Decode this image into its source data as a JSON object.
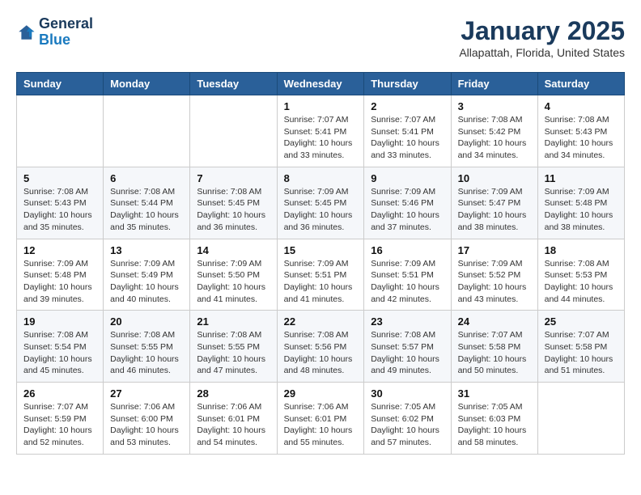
{
  "header": {
    "logo_line1": "General",
    "logo_line2": "Blue",
    "month_title": "January 2025",
    "location": "Allapattah, Florida, United States"
  },
  "days_of_week": [
    "Sunday",
    "Monday",
    "Tuesday",
    "Wednesday",
    "Thursday",
    "Friday",
    "Saturday"
  ],
  "weeks": [
    [
      {
        "day": "",
        "sunrise": "",
        "sunset": "",
        "daylight": ""
      },
      {
        "day": "",
        "sunrise": "",
        "sunset": "",
        "daylight": ""
      },
      {
        "day": "",
        "sunrise": "",
        "sunset": "",
        "daylight": ""
      },
      {
        "day": "1",
        "sunrise": "Sunrise: 7:07 AM",
        "sunset": "Sunset: 5:41 PM",
        "daylight": "Daylight: 10 hours and 33 minutes."
      },
      {
        "day": "2",
        "sunrise": "Sunrise: 7:07 AM",
        "sunset": "Sunset: 5:41 PM",
        "daylight": "Daylight: 10 hours and 33 minutes."
      },
      {
        "day": "3",
        "sunrise": "Sunrise: 7:08 AM",
        "sunset": "Sunset: 5:42 PM",
        "daylight": "Daylight: 10 hours and 34 minutes."
      },
      {
        "day": "4",
        "sunrise": "Sunrise: 7:08 AM",
        "sunset": "Sunset: 5:43 PM",
        "daylight": "Daylight: 10 hours and 34 minutes."
      }
    ],
    [
      {
        "day": "5",
        "sunrise": "Sunrise: 7:08 AM",
        "sunset": "Sunset: 5:43 PM",
        "daylight": "Daylight: 10 hours and 35 minutes."
      },
      {
        "day": "6",
        "sunrise": "Sunrise: 7:08 AM",
        "sunset": "Sunset: 5:44 PM",
        "daylight": "Daylight: 10 hours and 35 minutes."
      },
      {
        "day": "7",
        "sunrise": "Sunrise: 7:08 AM",
        "sunset": "Sunset: 5:45 PM",
        "daylight": "Daylight: 10 hours and 36 minutes."
      },
      {
        "day": "8",
        "sunrise": "Sunrise: 7:09 AM",
        "sunset": "Sunset: 5:45 PM",
        "daylight": "Daylight: 10 hours and 36 minutes."
      },
      {
        "day": "9",
        "sunrise": "Sunrise: 7:09 AM",
        "sunset": "Sunset: 5:46 PM",
        "daylight": "Daylight: 10 hours and 37 minutes."
      },
      {
        "day": "10",
        "sunrise": "Sunrise: 7:09 AM",
        "sunset": "Sunset: 5:47 PM",
        "daylight": "Daylight: 10 hours and 38 minutes."
      },
      {
        "day": "11",
        "sunrise": "Sunrise: 7:09 AM",
        "sunset": "Sunset: 5:48 PM",
        "daylight": "Daylight: 10 hours and 38 minutes."
      }
    ],
    [
      {
        "day": "12",
        "sunrise": "Sunrise: 7:09 AM",
        "sunset": "Sunset: 5:48 PM",
        "daylight": "Daylight: 10 hours and 39 minutes."
      },
      {
        "day": "13",
        "sunrise": "Sunrise: 7:09 AM",
        "sunset": "Sunset: 5:49 PM",
        "daylight": "Daylight: 10 hours and 40 minutes."
      },
      {
        "day": "14",
        "sunrise": "Sunrise: 7:09 AM",
        "sunset": "Sunset: 5:50 PM",
        "daylight": "Daylight: 10 hours and 41 minutes."
      },
      {
        "day": "15",
        "sunrise": "Sunrise: 7:09 AM",
        "sunset": "Sunset: 5:51 PM",
        "daylight": "Daylight: 10 hours and 41 minutes."
      },
      {
        "day": "16",
        "sunrise": "Sunrise: 7:09 AM",
        "sunset": "Sunset: 5:51 PM",
        "daylight": "Daylight: 10 hours and 42 minutes."
      },
      {
        "day": "17",
        "sunrise": "Sunrise: 7:09 AM",
        "sunset": "Sunset: 5:52 PM",
        "daylight": "Daylight: 10 hours and 43 minutes."
      },
      {
        "day": "18",
        "sunrise": "Sunrise: 7:08 AM",
        "sunset": "Sunset: 5:53 PM",
        "daylight": "Daylight: 10 hours and 44 minutes."
      }
    ],
    [
      {
        "day": "19",
        "sunrise": "Sunrise: 7:08 AM",
        "sunset": "Sunset: 5:54 PM",
        "daylight": "Daylight: 10 hours and 45 minutes."
      },
      {
        "day": "20",
        "sunrise": "Sunrise: 7:08 AM",
        "sunset": "Sunset: 5:55 PM",
        "daylight": "Daylight: 10 hours and 46 minutes."
      },
      {
        "day": "21",
        "sunrise": "Sunrise: 7:08 AM",
        "sunset": "Sunset: 5:55 PM",
        "daylight": "Daylight: 10 hours and 47 minutes."
      },
      {
        "day": "22",
        "sunrise": "Sunrise: 7:08 AM",
        "sunset": "Sunset: 5:56 PM",
        "daylight": "Daylight: 10 hours and 48 minutes."
      },
      {
        "day": "23",
        "sunrise": "Sunrise: 7:08 AM",
        "sunset": "Sunset: 5:57 PM",
        "daylight": "Daylight: 10 hours and 49 minutes."
      },
      {
        "day": "24",
        "sunrise": "Sunrise: 7:07 AM",
        "sunset": "Sunset: 5:58 PM",
        "daylight": "Daylight: 10 hours and 50 minutes."
      },
      {
        "day": "25",
        "sunrise": "Sunrise: 7:07 AM",
        "sunset": "Sunset: 5:58 PM",
        "daylight": "Daylight: 10 hours and 51 minutes."
      }
    ],
    [
      {
        "day": "26",
        "sunrise": "Sunrise: 7:07 AM",
        "sunset": "Sunset: 5:59 PM",
        "daylight": "Daylight: 10 hours and 52 minutes."
      },
      {
        "day": "27",
        "sunrise": "Sunrise: 7:06 AM",
        "sunset": "Sunset: 6:00 PM",
        "daylight": "Daylight: 10 hours and 53 minutes."
      },
      {
        "day": "28",
        "sunrise": "Sunrise: 7:06 AM",
        "sunset": "Sunset: 6:01 PM",
        "daylight": "Daylight: 10 hours and 54 minutes."
      },
      {
        "day": "29",
        "sunrise": "Sunrise: 7:06 AM",
        "sunset": "Sunset: 6:01 PM",
        "daylight": "Daylight: 10 hours and 55 minutes."
      },
      {
        "day": "30",
        "sunrise": "Sunrise: 7:05 AM",
        "sunset": "Sunset: 6:02 PM",
        "daylight": "Daylight: 10 hours and 57 minutes."
      },
      {
        "day": "31",
        "sunrise": "Sunrise: 7:05 AM",
        "sunset": "Sunset: 6:03 PM",
        "daylight": "Daylight: 10 hours and 58 minutes."
      },
      {
        "day": "",
        "sunrise": "",
        "sunset": "",
        "daylight": ""
      }
    ]
  ]
}
